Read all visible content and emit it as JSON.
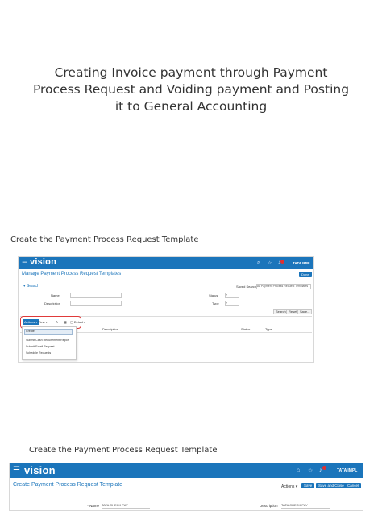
{
  "heading": "Creating Invoice payment through Payment Process Request and Voiding payment and Posting it to General Accounting",
  "captions": [
    "Create the Payment Process Request Template",
    "Create the Payment Process Request Template"
  ],
  "shot1": {
    "brand": "vision",
    "user": "TATA IMPL",
    "page_title": "Manage Payment Process Request Templates",
    "done_label": "Done",
    "search_label": "Search",
    "saved_search_label": "Saved Search",
    "saved_search_value": "All Payment Process Request Templates",
    "fields": {
      "name": "Name",
      "description": "Description",
      "status": "Status",
      "type": "Type"
    },
    "buttons": {
      "search": "Search",
      "reset": "Reset",
      "save": "Save..."
    },
    "toolbar": {
      "actions": "Actions",
      "view": "View",
      "detach": "Detach"
    },
    "columns": [
      "Description",
      "Status",
      "Type"
    ],
    "menu": [
      "Create",
      "Submit Cash Requirement Report",
      "Submit Email Request",
      "Schedule Requests"
    ]
  },
  "shot2": {
    "brand": "vision",
    "user": "TATA IMPL",
    "page_title": "Create Payment Process Request Template",
    "buttons": {
      "actions": "Actions",
      "save": "Save",
      "save_close": "Save and Close",
      "cancel": "Cancel"
    },
    "name_label": "Name",
    "name_value": "TATA CHECK PAY",
    "description_label": "Description",
    "description_value": "TATA CHECK PAY"
  },
  "colors": {
    "accent": "#1b75bb",
    "highlight": "#e03a3a"
  }
}
